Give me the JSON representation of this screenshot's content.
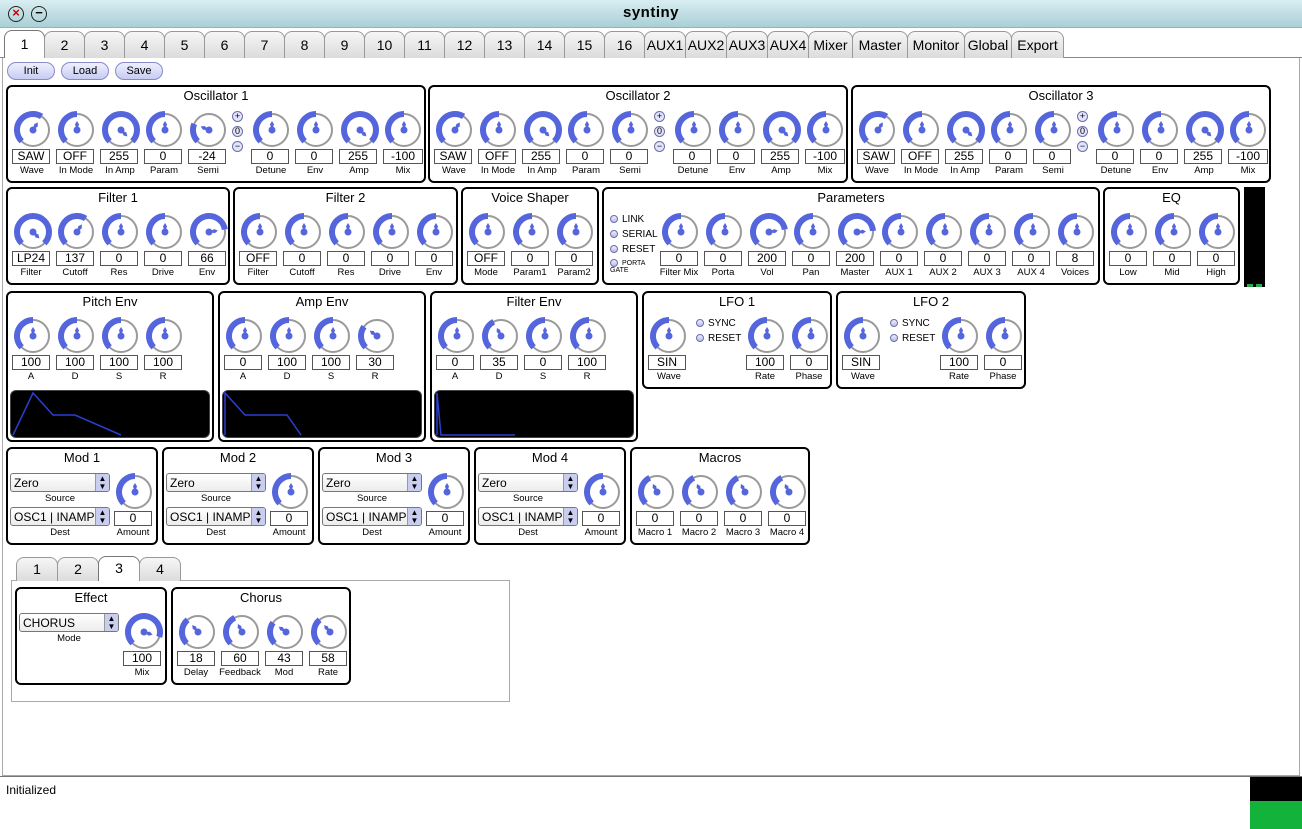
{
  "window": {
    "title": "syntiny"
  },
  "main_tabs": [
    "1",
    "2",
    "3",
    "4",
    "5",
    "6",
    "7",
    "8",
    "9",
    "10",
    "11",
    "12",
    "13",
    "14",
    "15",
    "16",
    "AUX1",
    "AUX2",
    "AUX3",
    "AUX4",
    "Mixer",
    "Master",
    "Monitor",
    "Global",
    "Export"
  ],
  "active_tab": "1",
  "toolbar": {
    "init": "Init",
    "load": "Load",
    "save": "Save"
  },
  "oscillators": [
    {
      "title": "Oscillator 1",
      "wave": "SAW",
      "in_mode": "OFF",
      "in_amp": "255",
      "param": "0",
      "semi": "-24",
      "detune": "0",
      "env": "0",
      "amp": "255",
      "mix": "-100",
      "octave_plus": "+",
      "octave_zero": "0",
      "octave_minus": "−"
    },
    {
      "title": "Oscillator 2",
      "wave": "SAW",
      "in_mode": "OFF",
      "in_amp": "255",
      "param": "0",
      "semi": "0",
      "detune": "0",
      "env": "0",
      "amp": "255",
      "mix": "-100",
      "octave_plus": "+",
      "octave_zero": "0",
      "octave_minus": "−"
    },
    {
      "title": "Oscillator 3",
      "wave": "SAW",
      "in_mode": "OFF",
      "in_amp": "255",
      "param": "0",
      "semi": "0",
      "detune": "0",
      "env": "0",
      "amp": "255",
      "mix": "-100",
      "octave_plus": "+",
      "octave_zero": "0",
      "octave_minus": "−"
    }
  ],
  "osc_labels": [
    "Wave",
    "In Mode",
    "In Amp",
    "Param",
    "Semi",
    "Detune",
    "Env",
    "Amp",
    "Mix"
  ],
  "filter1": {
    "title": "Filter 1",
    "values": [
      "LP24",
      "137",
      "0",
      "0",
      "66"
    ],
    "labels": [
      "Filter",
      "Cutoff",
      "Res",
      "Drive",
      "Env"
    ]
  },
  "filter2": {
    "title": "Filter 2",
    "values": [
      "OFF",
      "0",
      "0",
      "0",
      "0"
    ],
    "labels": [
      "Filter",
      "Cutoff",
      "Res",
      "Drive",
      "Env"
    ]
  },
  "voice_shaper": {
    "title": "Voice Shaper",
    "values": [
      "OFF",
      "0",
      "0"
    ],
    "labels": [
      "Mode",
      "Param1",
      "Param2"
    ]
  },
  "parameters": {
    "title": "Parameters",
    "radios": [
      "LINK",
      "SERIAL",
      "RESET",
      "PORTA GATE"
    ],
    "values": [
      "0",
      "0",
      "200",
      "0",
      "200",
      "0",
      "0",
      "0",
      "0",
      "8"
    ],
    "labels": [
      "Filter Mix",
      "Porta",
      "Vol",
      "Pan",
      "Master",
      "AUX 1",
      "AUX 2",
      "AUX 3",
      "AUX 4",
      "Voices"
    ]
  },
  "eq": {
    "title": "EQ",
    "values": [
      "0",
      "0",
      "0"
    ],
    "labels": [
      "Low",
      "Mid",
      "High"
    ]
  },
  "pitch_env": {
    "title": "Pitch Env",
    "values": [
      "100",
      "100",
      "100",
      "100"
    ],
    "labels": [
      "A",
      "D",
      "S",
      "R"
    ]
  },
  "amp_env": {
    "title": "Amp Env",
    "values": [
      "0",
      "100",
      "100",
      "30"
    ],
    "labels": [
      "A",
      "D",
      "S",
      "R"
    ]
  },
  "filter_env": {
    "title": "Filter Env",
    "values": [
      "0",
      "35",
      "0",
      "100"
    ],
    "labels": [
      "A",
      "D",
      "S",
      "R"
    ]
  },
  "lfo1": {
    "title": "LFO 1",
    "wave": "SIN",
    "rate": "100",
    "phase": "0",
    "sync": "SYNC",
    "reset": "RESET",
    "labels": [
      "Wave",
      "Rate",
      "Phase"
    ]
  },
  "lfo2": {
    "title": "LFO 2",
    "wave": "SIN",
    "rate": "100",
    "phase": "0",
    "sync": "SYNC",
    "reset": "RESET",
    "labels": [
      "Wave",
      "Rate",
      "Phase"
    ]
  },
  "mods": [
    {
      "title": "Mod 1",
      "source": "Zero",
      "dest": "OSC1 | INAMP",
      "amount": "0"
    },
    {
      "title": "Mod 2",
      "source": "Zero",
      "dest": "OSC1 | INAMP",
      "amount": "0"
    },
    {
      "title": "Mod 3",
      "source": "Zero",
      "dest": "OSC1 | INAMP",
      "amount": "0"
    },
    {
      "title": "Mod 4",
      "source": "Zero",
      "dest": "OSC1 | INAMP",
      "amount": "0"
    }
  ],
  "mod_labels": {
    "source": "Source",
    "dest": "Dest",
    "amount": "Amount"
  },
  "macros": {
    "title": "Macros",
    "values": [
      "0",
      "0",
      "0",
      "0"
    ],
    "labels": [
      "Macro 1",
      "Macro 2",
      "Macro 3",
      "Macro 4"
    ]
  },
  "fx_tabs": [
    "1",
    "2",
    "3",
    "4"
  ],
  "active_fx_tab": "3",
  "effect": {
    "title": "Effect",
    "mode": "CHORUS",
    "mode_label": "Mode",
    "mix": "100",
    "mix_label": "Mix"
  },
  "chorus": {
    "title": "Chorus",
    "values": [
      "18",
      "60",
      "43",
      "58"
    ],
    "labels": [
      "Delay",
      "Feedback",
      "Mod",
      "Rate"
    ]
  },
  "status": {
    "text": "Initialized"
  },
  "colors": {
    "knob_fill": "#5566dd",
    "knob_ring": "#9a9a9a",
    "env_line": "#2a3fcf",
    "meter_green": "#13b33b",
    "titlebar": "#b9dde3"
  }
}
